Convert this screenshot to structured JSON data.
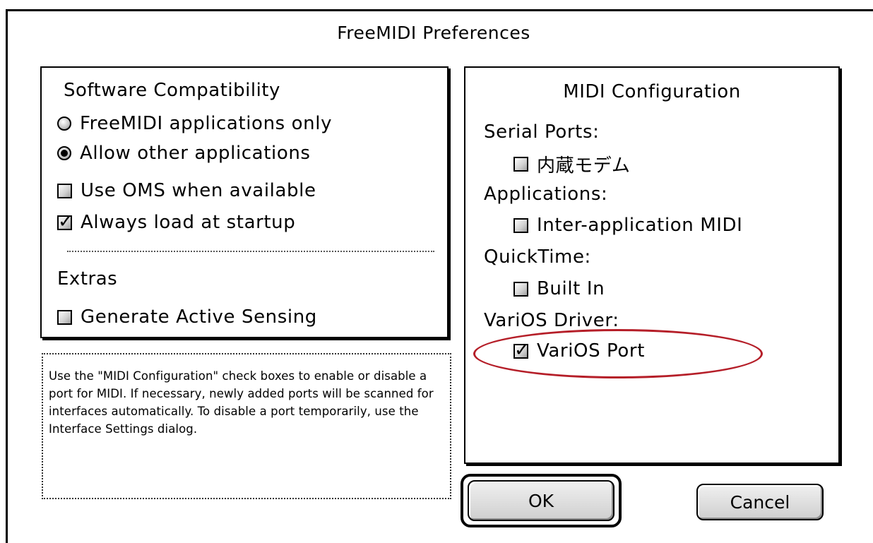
{
  "dialog": {
    "title": "FreeMIDI Preferences"
  },
  "software_compatibility": {
    "header": "Software Compatibility",
    "options": [
      {
        "label": "FreeMIDI applications only",
        "selected": false
      },
      {
        "label": "Allow other applications",
        "selected": true
      }
    ],
    "checkboxes": [
      {
        "label": "Use OMS when available",
        "checked": false
      },
      {
        "label": "Always load at startup",
        "checked": true
      }
    ],
    "extras_header": "Extras",
    "extras": [
      {
        "label": "Generate Active Sensing",
        "checked": false
      }
    ]
  },
  "help_text": "Use the \"MIDI Configuration\" check boxes to enable or disable a port for MIDI.  If necessary, newly added ports will be scanned for interfaces automatically.  To disable a port temporarily, use the Interface Settings dialog.",
  "midi_configuration": {
    "header": "MIDI Configuration",
    "groups": [
      {
        "label": "Serial Ports:",
        "item": "内蔵モデム",
        "checked": false
      },
      {
        "label": "Applications:",
        "item": "Inter-application MIDI",
        "checked": false
      },
      {
        "label": "QuickTime:",
        "item": "Built In",
        "checked": false
      },
      {
        "label": "VariOS Driver:",
        "item": "VariOS Port",
        "checked": true
      }
    ]
  },
  "buttons": {
    "ok": "OK",
    "cancel": "Cancel"
  },
  "colors": {
    "highlight": "#b51e28"
  }
}
